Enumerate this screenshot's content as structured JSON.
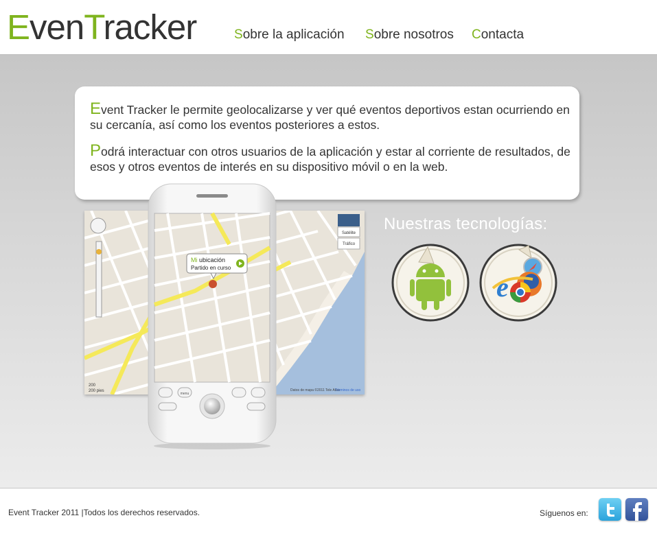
{
  "header": {
    "logo": {
      "part1_cap": "E",
      "part1_rest": "ven",
      "part2_cap": "T",
      "part2_rest": "racker"
    },
    "nav": [
      {
        "cap": "S",
        "rest": "obre la aplicación"
      },
      {
        "cap": "S",
        "rest": "obre nosotros"
      },
      {
        "cap": "C",
        "rest": "ontacta"
      }
    ]
  },
  "intro": {
    "p1_cap": "E",
    "p1_rest": "vent Tracker le permite geolocalizarse y ver qué eventos deportivos estan ocurriendo en su cercanía, así como los eventos posteriores a estos.",
    "p2_cap": "P",
    "p2_rest": "odrá interactuar con otros usuarios de la aplicación y estar al corriente de resultados, de esos y otros eventos de interés en su dispositivo móvil o en la web."
  },
  "map": {
    "satellite_label": "Satélite",
    "traffic_label": "Tráfico",
    "scale_label_1": "200",
    "scale_label_2": "200 pies",
    "copyright": "Datos de mapa ©2011 Tele Atlas",
    "terms": "Términos de uso"
  },
  "phone": {
    "bubble_cap": "Mi",
    "bubble_title": " ubicación",
    "bubble_subtitle": "Partido en curso",
    "menu_label": "menu"
  },
  "tech": {
    "title": "Nuestras tecnologías:",
    "items": [
      "android-icon",
      "browsers-icon"
    ]
  },
  "footer": {
    "copyright": "Event Tracker 2011  |Todos los derechos reservados.",
    "follow": "Síguenos en:",
    "social": [
      "twitter-icon",
      "facebook-icon"
    ]
  },
  "colors": {
    "accent": "#7fb41e",
    "text": "#333333",
    "band": "#d0d0d0"
  }
}
